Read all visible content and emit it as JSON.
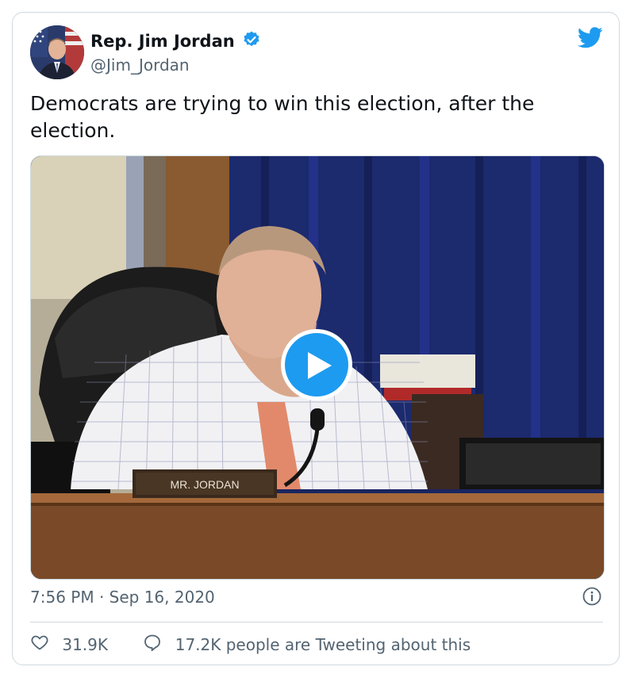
{
  "tweet": {
    "author_name": "Rep. Jim Jordan",
    "author_handle": "@Jim_Jordan",
    "text": "Democrats are trying to win this election, after the election.",
    "timestamp": "7:56 PM · Sep 16, 2020",
    "media": {
      "type": "video",
      "nameplate_text": "MR. JORDAN"
    },
    "actions": {
      "likes": "31.9K",
      "tweeting_label": "17.2K people are Tweeting about this"
    }
  },
  "icons": {
    "verified": "verified-badge-icon",
    "brand": "twitter-bird-icon",
    "play": "play-icon",
    "info": "info-icon",
    "like": "heart-icon",
    "reply": "speech-bubble-icon"
  },
  "colors": {
    "accent": "#1d9bf0",
    "text": "#0f1419",
    "secondary_text": "#536471",
    "border": "#cfd9de"
  }
}
